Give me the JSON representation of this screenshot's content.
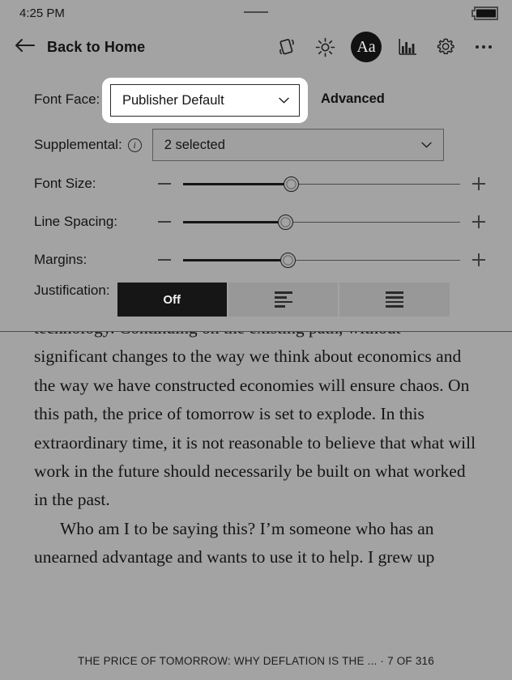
{
  "status_bar": {
    "time": "4:25 PM",
    "battery_icon": "battery-full-icon",
    "drag_handle": "drag-handle"
  },
  "toolbar": {
    "back_label": "Back to Home",
    "back_icon": "arrow-left-icon",
    "icons": [
      {
        "name": "rotate-orientation-icon",
        "label": "Orientation"
      },
      {
        "name": "brightness-sun-icon",
        "label": "Brightness"
      },
      {
        "name": "font-aa-icon",
        "label": "Aa",
        "active": true
      },
      {
        "name": "reading-stats-bar-chart-icon",
        "label": "Reading Stats"
      },
      {
        "name": "gear-icon",
        "label": "Settings"
      },
      {
        "name": "overflow-menu-icon",
        "label": "More"
      }
    ]
  },
  "settings": {
    "font_face": {
      "label": "Font Face:",
      "value": "Publisher Default",
      "advanced_label": "Advanced",
      "focused": true
    },
    "supplemental": {
      "label": "Supplemental:",
      "info_icon": "info-circle-icon",
      "value": "2 selected"
    },
    "sliders": [
      {
        "label": "Font Size:",
        "percent": 39,
        "minus": "−",
        "plus": "+"
      },
      {
        "label": "Line Spacing:",
        "percent": 37,
        "minus": "−",
        "plus": "+"
      },
      {
        "label": "Margins:",
        "percent": 38,
        "minus": "−",
        "plus": "+"
      }
    ],
    "justification": {
      "label": "Justification:",
      "options": [
        {
          "name": "justification-off",
          "label": "Off",
          "selected": true
        },
        {
          "name": "justification-left-align",
          "label": "",
          "selected": false
        },
        {
          "name": "justification-full",
          "label": "",
          "selected": false
        }
      ]
    }
  },
  "page": {
    "paragraphs": [
      "pretend they are working because they did in an era before technology. Continuing on the existing path, without significant changes to the way we think about economics and the way we have constructed economies will ensure chaos. On this path, the price of tomorrow is set to explode. In this extraordinary time, it is not reasonable to believe that what will work in the future should necessarily be built on what worked in the past.",
      "Who am I to be saying this? I’m someone who has an unearned advantage and wants to use it to help. I grew up"
    ],
    "footer": "THE PRICE OF TOMORROW: WHY DEFLATION IS THE ... · 7 OF 316"
  },
  "colors": {
    "background": "#a3a3a3",
    "text": "#141414",
    "accent_dark": "#161616",
    "panel_border": "#4d4d4d",
    "focus_ring": "#ffffff"
  }
}
